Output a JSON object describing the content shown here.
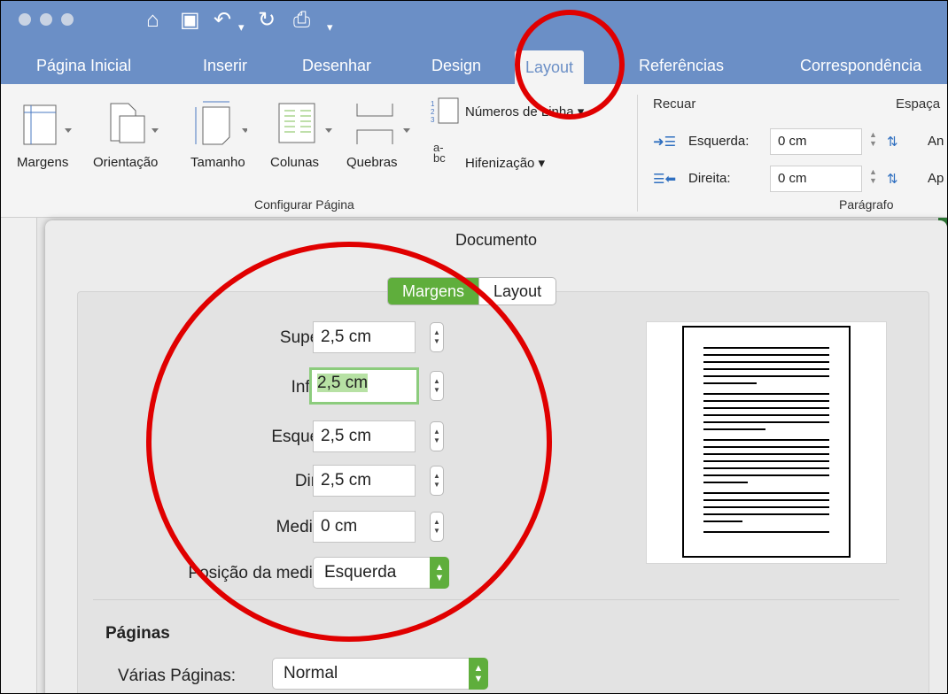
{
  "quick_access": {
    "home_glyph": "⌂",
    "save_glyph": "▣",
    "undo_glyph": "↶",
    "redo_glyph": "↻",
    "print_glyph": "⎙",
    "more_glyph": "▾"
  },
  "tabs": [
    "Página Inicial",
    "Inserir",
    "Desenhar",
    "Design",
    "Layout",
    "Referências",
    "Correspondência"
  ],
  "active_tab": "Layout",
  "ribbon": {
    "margens": "Margens",
    "orientacao": "Orientação",
    "tamanho": "Tamanho",
    "colunas": "Colunas",
    "quebras": "Quebras",
    "numeros_linha": "Números de Linha ▾",
    "hifenizacao": "Hifenização ▾",
    "hifen_glyph": "a-\nbc",
    "group_configurar": "Configurar Página",
    "recuar": "Recuar",
    "espacamento": "Espaça",
    "esquerda_label": "Esquerda:",
    "esquerda_value": "0 cm",
    "direita_label": "Direita:",
    "direita_value": "0 cm",
    "antes_short": "An",
    "apos_short": "Ap",
    "group_paragrafo": "Parágrafo"
  },
  "dialog": {
    "title": "Documento",
    "tab_margens": "Margens",
    "tab_layout": "Layout",
    "fields": [
      {
        "label": "Superior:",
        "value": "2,5 cm"
      },
      {
        "label": "Inferior:",
        "value": "2,5 cm"
      },
      {
        "label": "Esquerda:",
        "value": "2,5 cm"
      },
      {
        "label": "Direita:",
        "value": "2,5 cm"
      },
      {
        "label": "Medianiz:",
        "value": "0 cm"
      }
    ],
    "posicao_label": "Posição da medianiz:",
    "posicao_value": "Esquerda",
    "paginas_heading": "Páginas",
    "varias_label": "Várias Páginas:",
    "varias_value": "Normal"
  },
  "colors": {
    "ribbon_blue": "#6b8fc6",
    "accent_green": "#5fae3c",
    "annotation_red": "#e00000"
  }
}
